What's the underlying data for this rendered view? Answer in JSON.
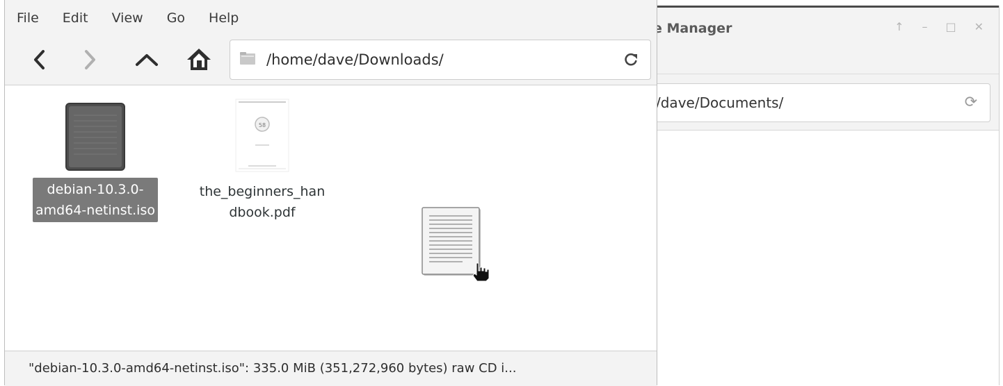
{
  "background_window": {
    "title": "e Manager",
    "path": "/dave/Documents/",
    "controls": [
      "↑",
      "–",
      "□",
      "✕"
    ]
  },
  "menubar": {
    "items": [
      "File",
      "Edit",
      "View",
      "Go",
      "Help"
    ]
  },
  "toolbar": {
    "back_icon": "chevron-left-icon",
    "forward_icon": "chevron-right-icon",
    "up_icon": "chevron-up-icon",
    "home_icon": "home-icon",
    "path": "/home/dave/Downloads/",
    "reload_icon": "reload-icon"
  },
  "files": [
    {
      "name": "debian-10.3.0-amd64-netinst.iso",
      "label_line1": "debian-10.3.0-",
      "label_line2": "amd64-netinst.iso",
      "selected": true
    },
    {
      "name": "the_beginners_handbook.pdf",
      "label_line1": "the_beginners_han",
      "label_line2": "dbook.pdf",
      "selected": false
    }
  ],
  "statusbar": {
    "text": "\"debian-10.3.0-amd64-netinst.iso\": 335.0 MiB (351,272,960 bytes) raw CD i..."
  }
}
